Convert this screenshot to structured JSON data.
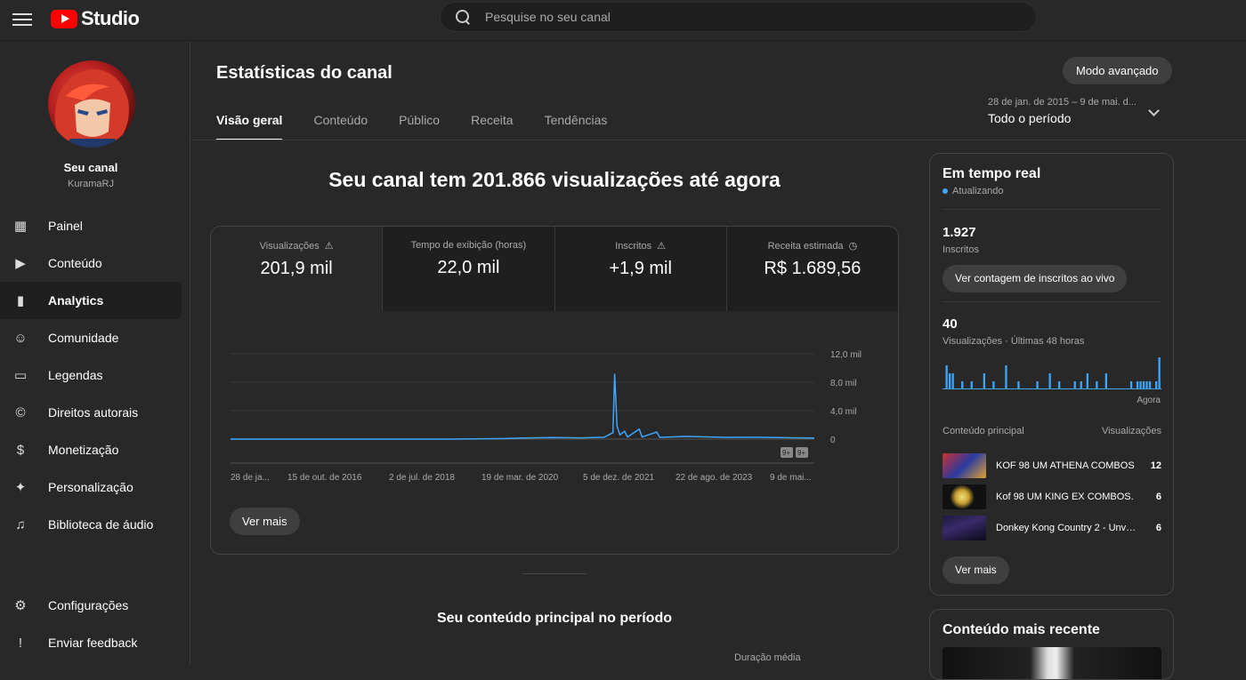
{
  "app": {
    "logo_text": "Studio",
    "search_placeholder": "Pesquise no seu canal"
  },
  "sidebar": {
    "channel_name": "Seu canal",
    "channel_handle": "KuramaRJ",
    "items": [
      {
        "label": "Painel",
        "icon": "dashboard-icon",
        "glyph": "▦"
      },
      {
        "label": "Conteúdo",
        "icon": "content-icon",
        "glyph": "▶"
      },
      {
        "label": "Analytics",
        "icon": "analytics-icon",
        "glyph": "▮",
        "active": true
      },
      {
        "label": "Comunidade",
        "icon": "community-icon",
        "glyph": "☺"
      },
      {
        "label": "Legendas",
        "icon": "subtitles-icon",
        "glyph": "▭"
      },
      {
        "label": "Direitos autorais",
        "icon": "copyright-icon",
        "glyph": "©"
      },
      {
        "label": "Monetização",
        "icon": "monetization-icon",
        "glyph": "$"
      },
      {
        "label": "Personalização",
        "icon": "customization-icon",
        "glyph": "✦"
      },
      {
        "label": "Biblioteca de áudio",
        "icon": "audio-library-icon",
        "glyph": "♫"
      }
    ],
    "bottom_items": [
      {
        "label": "Configurações",
        "icon": "gear-icon",
        "glyph": "⚙"
      },
      {
        "label": "Enviar feedback",
        "icon": "feedback-icon",
        "glyph": "!"
      }
    ]
  },
  "main": {
    "title": "Estatísticas do canal",
    "advanced_button": "Modo avançado",
    "tabs": [
      "Visão geral",
      "Conteúdo",
      "Público",
      "Receita",
      "Tendências"
    ],
    "period_range": "28 de jan. de 2015 – 9 de mai. d...",
    "period_label": "Todo o período",
    "headline": "Seu canal tem 201.866 visualizações até agora",
    "metrics": [
      {
        "label": "Visualizações",
        "value": "201,9 mil",
        "warn": true
      },
      {
        "label": "Tempo de exibição (horas)",
        "value": "22,0 mil",
        "warn": false
      },
      {
        "label": "Inscritos",
        "value": "+1,9 mil",
        "warn": true
      },
      {
        "label": "Receita estimada",
        "value": "R$ 1.689,56",
        "clock": true
      }
    ],
    "ver_mais": "Ver mais",
    "content_title": "Seu conteúdo principal no período",
    "duration_label": "Duração média"
  },
  "chart_data": {
    "type": "line",
    "y_ticks": [
      "12,0 mil",
      "8,0 mil",
      "4,0 mil",
      "0"
    ],
    "ylim": [
      0,
      12000
    ],
    "x_ticks": [
      "28 de ja...",
      "15 de out. de 2016",
      "2 de jul. de 2018",
      "19 de mar. de 2020",
      "5 de dez. de 2021",
      "22 de ago. de 2023",
      "9 de mai..."
    ],
    "series": [
      {
        "color": "#3ea6ff",
        "points": [
          [
            0,
            0
          ],
          [
            0.38,
            0
          ],
          [
            0.47,
            80
          ],
          [
            0.5,
            150
          ],
          [
            0.55,
            220
          ],
          [
            0.6,
            180
          ],
          [
            0.64,
            260
          ],
          [
            0.655,
            900
          ],
          [
            0.658,
            9200
          ],
          [
            0.662,
            1800
          ],
          [
            0.667,
            600
          ],
          [
            0.675,
            1100
          ],
          [
            0.68,
            300
          ],
          [
            0.7,
            1400
          ],
          [
            0.705,
            300
          ],
          [
            0.73,
            1000
          ],
          [
            0.735,
            250
          ],
          [
            0.78,
            380
          ],
          [
            0.85,
            250
          ],
          [
            0.9,
            260
          ],
          [
            0.95,
            200
          ],
          [
            1.0,
            150
          ]
        ]
      }
    ],
    "badges": [
      "9+",
      "9+"
    ]
  },
  "realtime": {
    "title": "Em tempo real",
    "status": "Atualizando",
    "subscribers_value": "1.927",
    "subscribers_label": "Inscritos",
    "live_button": "Ver contagem de inscritos ao vivo",
    "views_value": "40",
    "views_label": "Visualizações · Últimas 48 horas",
    "bars": [
      0,
      3,
      2,
      2,
      0,
      0,
      1,
      0,
      0,
      1,
      0,
      0,
      0,
      2,
      0,
      0,
      1,
      0,
      0,
      0,
      3,
      0,
      0,
      0,
      1,
      0,
      0,
      0,
      0,
      0,
      1,
      0,
      0,
      0,
      2,
      0,
      0,
      1,
      0,
      0,
      0,
      0,
      1,
      0,
      1,
      0,
      2,
      0,
      0,
      1,
      0,
      0,
      2,
      0,
      0,
      0,
      0,
      0,
      0,
      0,
      1,
      0,
      1,
      1,
      1,
      1,
      1,
      0,
      1,
      4
    ],
    "now_label": "Agora",
    "top_header_left": "Conteúdo principal",
    "top_header_right": "Visualizações",
    "top_items": [
      {
        "title": "KOF 98 UM ATHENA COMBOS",
        "value": "12"
      },
      {
        "title": "Kof 98 UM KING EX COMBOS.",
        "value": "6"
      },
      {
        "title": "Donkey Kong Country 2 - Unvei...",
        "value": "6"
      }
    ],
    "ver_mais": "Ver mais"
  },
  "recent": {
    "title": "Conteúdo mais recente"
  }
}
